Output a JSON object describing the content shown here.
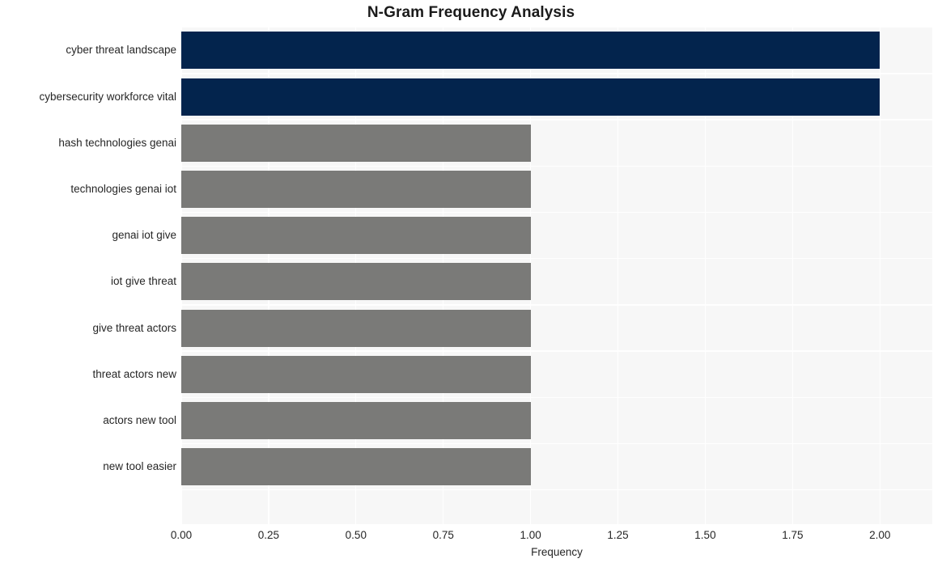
{
  "chart_data": {
    "type": "bar",
    "orientation": "horizontal",
    "title": "N-Gram Frequency Analysis",
    "xlabel": "Frequency",
    "ylabel": "",
    "xlim": [
      0.0,
      2.15
    ],
    "xticks": [
      "0.00",
      "0.25",
      "0.50",
      "0.75",
      "1.00",
      "1.25",
      "1.50",
      "1.75",
      "2.00"
    ],
    "xtick_values": [
      0.0,
      0.25,
      0.5,
      0.75,
      1.0,
      1.25,
      1.5,
      1.75,
      2.0
    ],
    "grid": true,
    "legend": "none",
    "categories": [
      "cyber threat landscape",
      "cybersecurity workforce vital",
      "hash technologies genai",
      "technologies genai iot",
      "genai iot give",
      "iot give threat",
      "give threat actors",
      "threat actors new",
      "actors new tool",
      "new tool easier"
    ],
    "values": [
      2,
      2,
      1,
      1,
      1,
      1,
      1,
      1,
      1,
      1
    ],
    "bar_colors": [
      "#03244d",
      "#03244d",
      "#7a7a78",
      "#7a7a78",
      "#7a7a78",
      "#7a7a78",
      "#7a7a78",
      "#7a7a78",
      "#7a7a78",
      "#7a7a78"
    ]
  },
  "style": {
    "figure_background": "#ffffff",
    "plot_background": "#f7f7f7",
    "gridline_color": "#ffffff",
    "highlight_color": "#03244d",
    "default_bar_color": "#7a7a78",
    "text_color": "#262626",
    "title_color": "#1a1a1a"
  }
}
